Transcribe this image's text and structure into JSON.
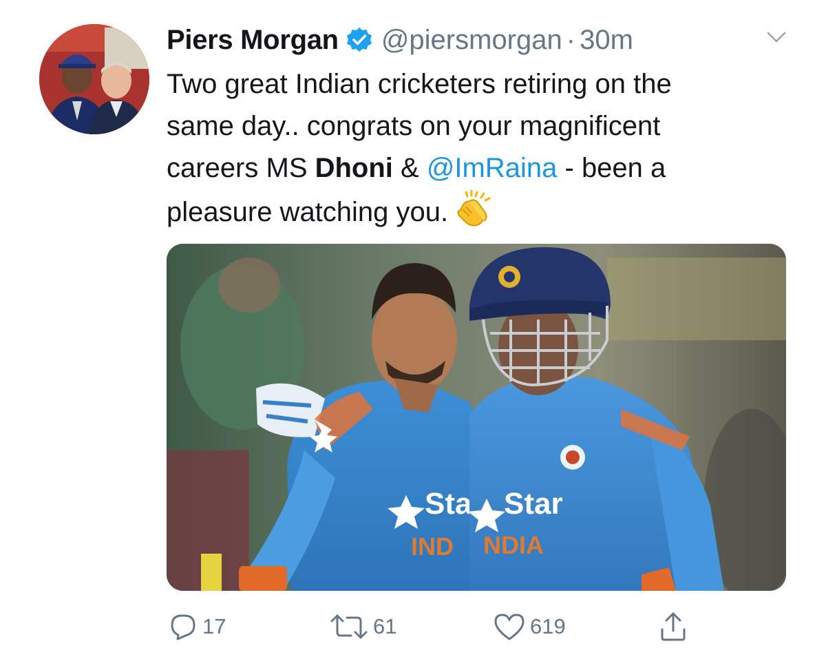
{
  "tweet": {
    "author_name": "Piers Morgan",
    "handle": "@piersmorgan",
    "separator": "·",
    "time": "30m",
    "text": {
      "line1": "Two great Indian cricketers retiring on the",
      "line2": "same day.. congrats on your magnificent",
      "line3_pre": "careers MS ",
      "line3_bold": "Dhoni",
      "line3_mid": " & ",
      "line3_mention": "@ImRaina",
      "line3_post": " - been a",
      "line4": "pleasure watching you."
    },
    "media": {
      "jersey_text_left": "Sta",
      "jersey_text_right": "Star",
      "jersey_country_left": "IND",
      "jersey_country_right": "NDIA"
    },
    "actions": {
      "replies": "17",
      "retweets": "61",
      "likes": "619"
    }
  },
  "colors": {
    "text": "#14171a",
    "secondary": "#657786",
    "link": "#1b95e0",
    "verified": "#1da1f2"
  },
  "icons": {
    "verified": "verified-badge-icon",
    "caret": "chevron-down-icon",
    "clap": "clapping-hands-emoji",
    "reply": "reply-icon",
    "retweet": "retweet-icon",
    "like": "heart-icon",
    "share": "share-icon"
  }
}
